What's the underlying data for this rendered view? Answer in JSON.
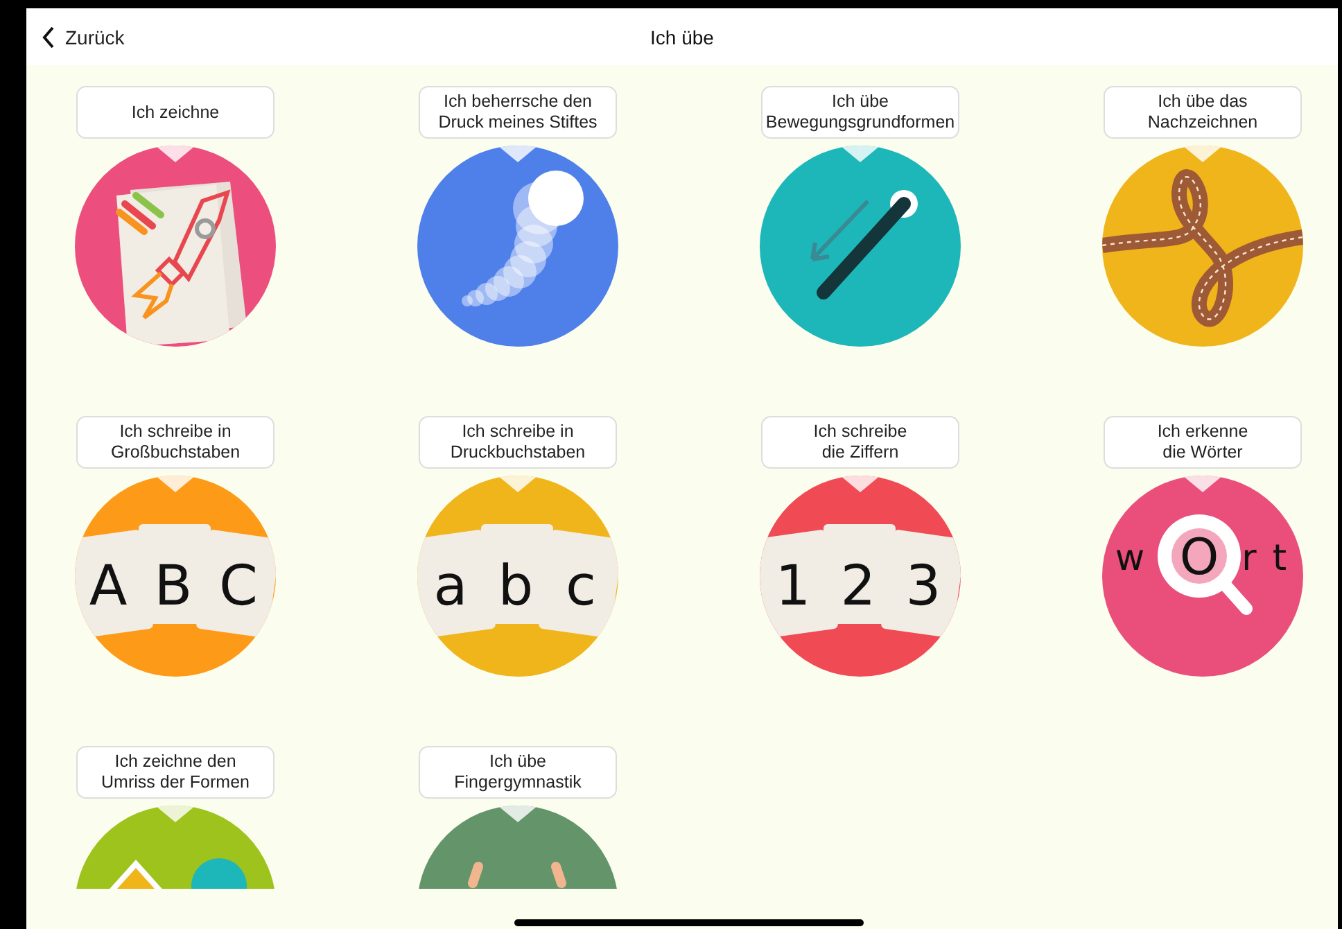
{
  "nav": {
    "back": "Zurück",
    "title": "Ich übe"
  },
  "tiles": [
    {
      "label": [
        "Ich zeichne"
      ],
      "color": "#ec4f7e",
      "art": {
        "kind": "rocket"
      }
    },
    {
      "label": [
        "Ich beherrsche den",
        "Druck meines Stiftes"
      ],
      "color": "#4f80ea",
      "art": {
        "kind": "pressure"
      }
    },
    {
      "label": [
        "Ich übe",
        "Bewegungsgrundformen"
      ],
      "color": "#1db6b9",
      "art": {
        "kind": "stroke"
      }
    },
    {
      "label": [
        "Ich übe das",
        "Nachzeichnen"
      ],
      "color": "#efb51a",
      "art": {
        "kind": "road"
      }
    },
    {
      "label": [
        "Ich schreibe in",
        "Großbuchstaben"
      ],
      "color": "#fd9a17",
      "art": {
        "kind": "cards",
        "letters": [
          "A",
          "B",
          "C"
        ]
      }
    },
    {
      "label": [
        "Ich schreibe in",
        "Druckbuchstaben"
      ],
      "color": "#efb51a",
      "art": {
        "kind": "cards",
        "letters": [
          "a",
          "b",
          "c"
        ]
      }
    },
    {
      "label": [
        "Ich schreibe",
        "die Ziffern"
      ],
      "color": "#f04a55",
      "art": {
        "kind": "cards",
        "letters": [
          "1",
          "2",
          "3"
        ]
      }
    },
    {
      "label": [
        "Ich erkenne",
        "die Wörter"
      ],
      "color": "#ea4f7c",
      "art": {
        "kind": "magnifier",
        "letters": [
          "w",
          "O",
          "r",
          "t"
        ]
      }
    },
    {
      "label": [
        "Ich zeichne den",
        "Umriss der Formen"
      ],
      "color": "#9dc31c",
      "art": {
        "kind": "shapes"
      }
    },
    {
      "label": [
        "Ich übe",
        "Fingergymnastik"
      ],
      "color": "#64946a",
      "art": {
        "kind": "hands"
      }
    }
  ]
}
